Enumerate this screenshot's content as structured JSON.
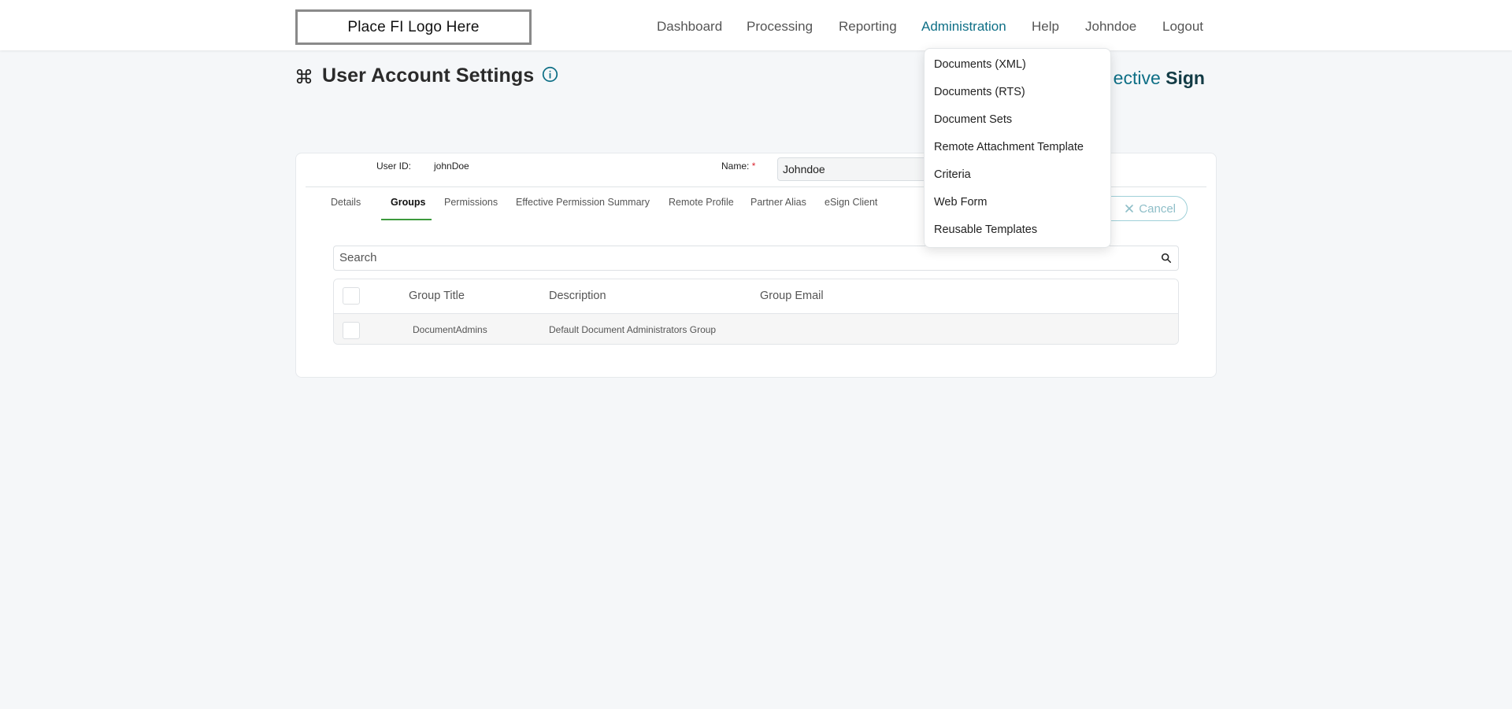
{
  "header": {
    "logo_text": "Place FI Logo Here",
    "nav": [
      {
        "label": "Dashboard"
      },
      {
        "label": "Processing"
      },
      {
        "label": "Reporting"
      },
      {
        "label": "Administration",
        "active": true
      },
      {
        "label": "Help"
      },
      {
        "label": "Johndoe"
      },
      {
        "label": "Logout"
      }
    ]
  },
  "page": {
    "title": "User Account Settings",
    "brand_prefix": "ective ",
    "brand_bold": "Sign"
  },
  "user": {
    "user_id_label": "User ID:",
    "user_id_value": "johnDoe",
    "name_label": "Name:",
    "name_required": "*",
    "name_value": "Johndoe"
  },
  "tabs": [
    {
      "label": "Details"
    },
    {
      "label": "Groups",
      "active": true
    },
    {
      "label": "Permissions"
    },
    {
      "label": "Effective Permission Summary"
    },
    {
      "label": "Remote Profile"
    },
    {
      "label": "Partner Alias"
    },
    {
      "label": "eSign Client"
    }
  ],
  "actions": {
    "cancel_label": "Cancel"
  },
  "search": {
    "placeholder": "Search"
  },
  "table": {
    "columns": [
      "Group Title",
      "Description",
      "Group Email"
    ],
    "rows": [
      {
        "group_title": "DocumentAdmins",
        "description": "Default Document Administrators Group",
        "group_email": ""
      }
    ]
  },
  "admin_menu": {
    "items": [
      {
        "label": "Documents (XML)"
      },
      {
        "label": "Documents (RTS)"
      },
      {
        "label": "Document Sets"
      },
      {
        "label": "Remote Attachment Template"
      },
      {
        "label": "Criteria"
      },
      {
        "label": "Web Form"
      },
      {
        "label": "Reusable Templates"
      }
    ]
  },
  "colors": {
    "accent": "#0e6f86",
    "active_tab_underline": "#3c9a3c",
    "required": "#d9232e"
  }
}
